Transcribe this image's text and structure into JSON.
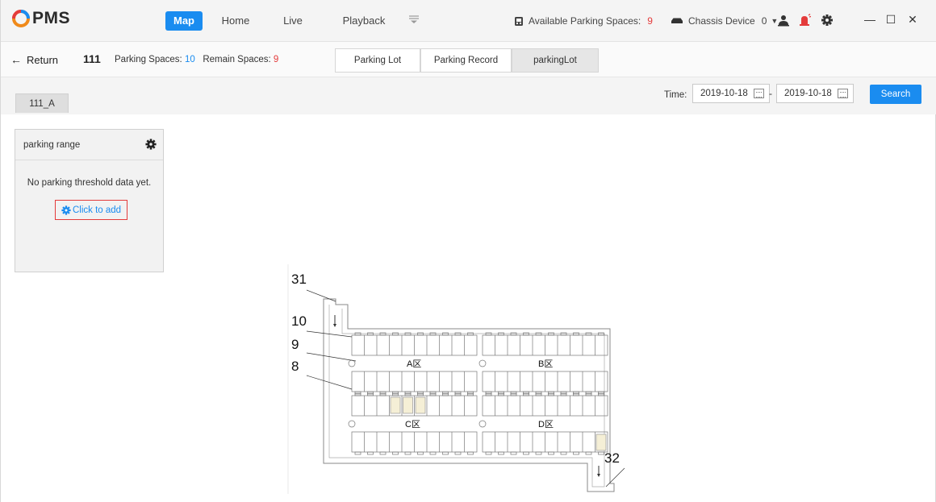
{
  "app": {
    "logo_text": "PMS"
  },
  "nav": {
    "tabs": [
      {
        "label": "Map",
        "active": true
      },
      {
        "label": "Home",
        "active": false
      },
      {
        "label": "Live",
        "active": false
      },
      {
        "label": "Playback",
        "active": false
      }
    ]
  },
  "status": {
    "available_label": "Available Parking Spaces:",
    "available_count": "9",
    "chassis_label": "Chassis Device",
    "chassis_count": "0"
  },
  "subbar": {
    "return_label": "Return",
    "lot_name": "111",
    "parking_spaces_label": "Parking Spaces:",
    "parking_spaces_value": "10",
    "remain_spaces_label": "Remain Spaces:",
    "remain_spaces_value": "9",
    "views": [
      {
        "label": "Parking Lot",
        "selected": false
      },
      {
        "label": "Parking Record",
        "selected": false
      },
      {
        "label": "parkingLot",
        "selected": true
      }
    ]
  },
  "filter": {
    "area_tab": "111_A",
    "time_label": "Time:",
    "start_date": "2019-10-18",
    "separator": "-",
    "end_date": "2019-10-18",
    "search_label": "Search"
  },
  "panel": {
    "title": "parking range",
    "empty_text": "No parking threshold data yet.",
    "add_label": "Click to add"
  },
  "map": {
    "labels": [
      "31",
      "10",
      "9",
      "8",
      "32"
    ],
    "zones": [
      "A区",
      "B区",
      "C区",
      "D区"
    ]
  },
  "colors": {
    "accent": "#1a8cf0",
    "alert": "#e43b3b"
  }
}
